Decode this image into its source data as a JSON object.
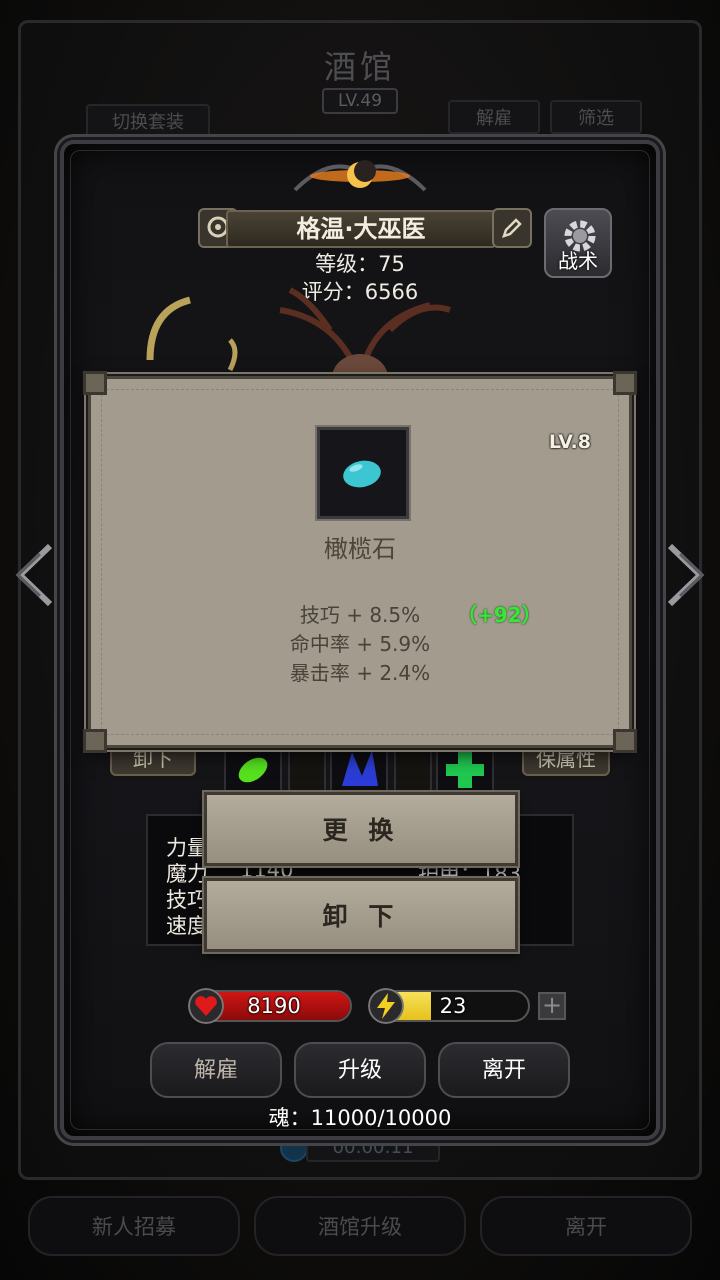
{
  "background": {
    "title": "酒馆",
    "level": "LV.49",
    "switch_outfit_label": "切换套装",
    "dismiss_label": "解雇",
    "filter_label": "筛选",
    "timer": "00:00:11",
    "bottom": {
      "recruit_label": "新人招募",
      "upgrade_tavern_label": "酒馆升级",
      "leave_label": "离开"
    }
  },
  "hero": {
    "name": "格温·大巫医",
    "level_line": "等级：75",
    "score_line": "评分：6566",
    "tactic_label": "战术",
    "unequip_label": "卸下",
    "remove_label": "保属性",
    "attributes": {
      "rows": [
        "力量",
        "魔力",
        "技巧",
        "速度"
      ],
      "mana_value": "1140",
      "armor_label": "护甲：183"
    },
    "hp": {
      "value": "8190",
      "fraction": 1.0,
      "color": "#d11515"
    },
    "energy": {
      "value": "23",
      "fraction": 0.35,
      "color": "#e6c21a"
    },
    "actions": {
      "dismiss_label": "解雇",
      "upgrade_label": "升级",
      "leave_label": "离开"
    },
    "soul_line": "魂：11000/10000"
  },
  "gem_popup": {
    "level": "LV.8",
    "name": "橄榄石",
    "stats": [
      "技巧 + 8.5%",
      "命中率 + 5.9%",
      "暴击率 + 2.4%"
    ],
    "bonus": "（+92）",
    "gem_color": "#3cc6d2"
  },
  "menu": {
    "replace_label": "更 换",
    "unequip_label": "卸 下"
  },
  "icons": {
    "left_arrow": "chevron-left-icon",
    "right_arrow": "chevron-right-icon",
    "gear": "gear-icon",
    "heart": "heart-icon",
    "lightning": "lightning-icon",
    "medal": "medal-icon",
    "edit": "edit-icon"
  }
}
